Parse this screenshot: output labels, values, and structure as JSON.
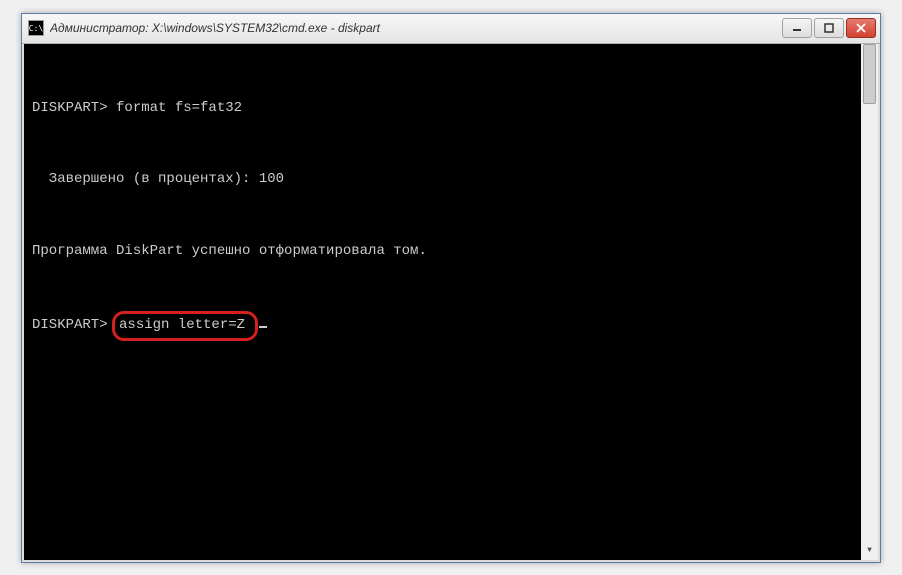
{
  "window": {
    "title": "Администратор: X:\\windows\\SYSTEM32\\cmd.exe - diskpart",
    "icon_label": "C:\\"
  },
  "controls": {
    "minimize": "–",
    "maximize": "□",
    "close": "×"
  },
  "console": {
    "lines": {
      "l0": "",
      "l1_prompt": "DISKPART> ",
      "l1_cmd": "format fs=fat32",
      "l2": "",
      "l3": "  Завершено (в процентах): 100",
      "l4": "",
      "l5": "Программа DiskPart успешно отформатировала том.",
      "l6": "",
      "l7_prompt": "DISKPART> ",
      "l7_cmd": "assign letter=Z"
    }
  }
}
